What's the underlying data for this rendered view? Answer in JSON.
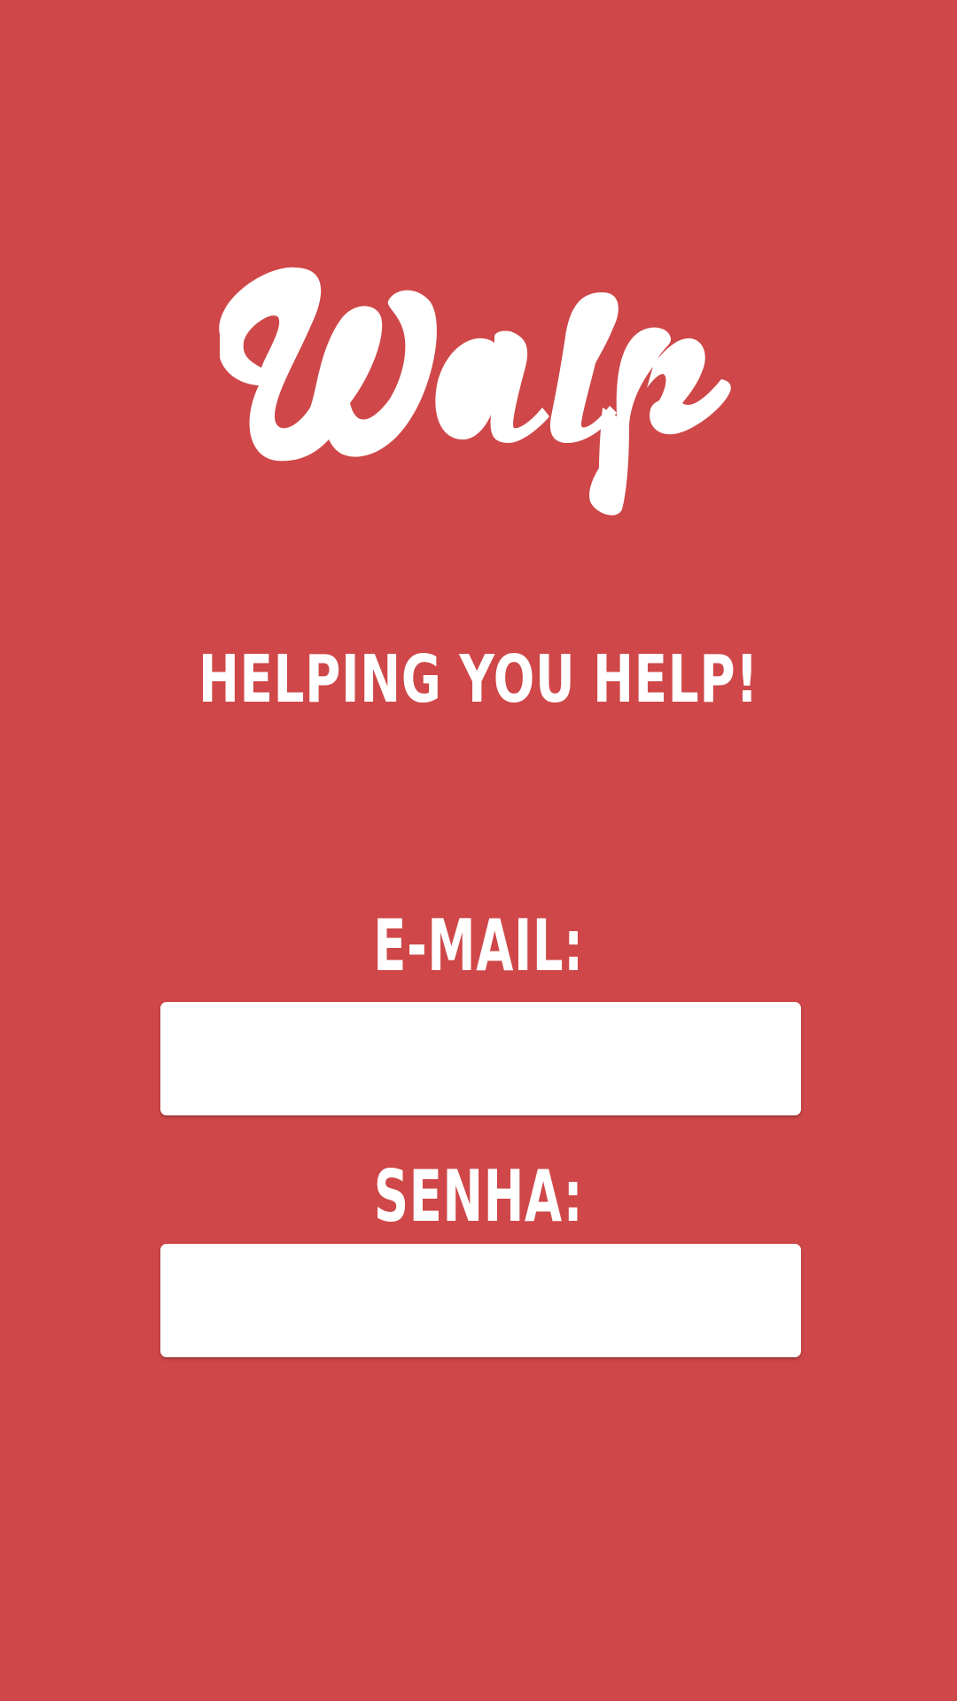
{
  "app": {
    "logo_text": "Walp",
    "tagline": "HELPING YOU HELP!"
  },
  "login": {
    "email_label": "E-MAIL:",
    "email_value": "",
    "password_label": "SENHA:",
    "password_value": ""
  },
  "colors": {
    "background": "#CF4748",
    "foreground": "#FFFFFF"
  }
}
